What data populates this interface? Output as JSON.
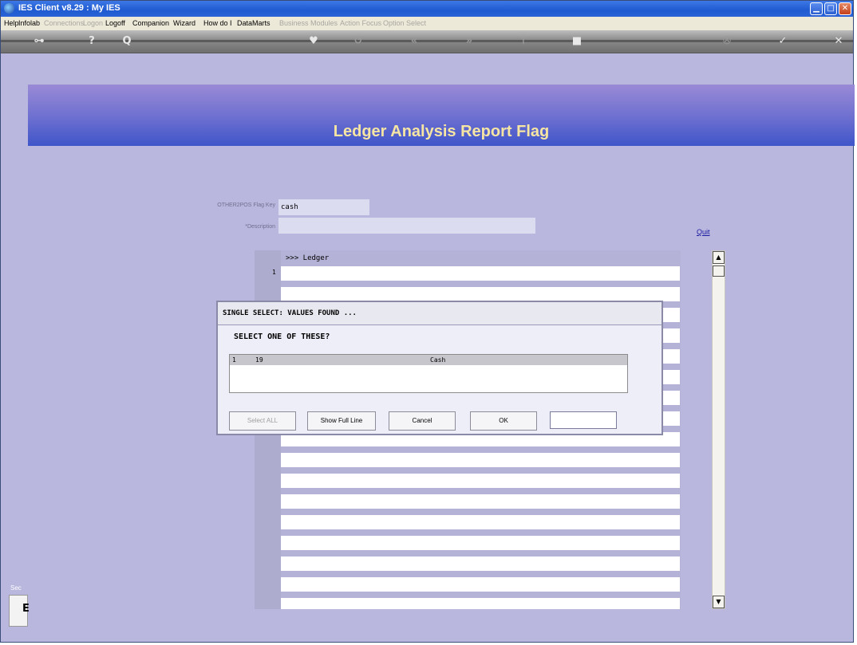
{
  "window": {
    "title": "IES Client v8.29 : My IES"
  },
  "menu": {
    "items": [
      {
        "label": "Help",
        "enabled": true
      },
      {
        "label": "Infolab",
        "enabled": true
      },
      {
        "label": "Connections",
        "enabled": false
      },
      {
        "label": "Logon",
        "enabled": false
      },
      {
        "label": "Logoff",
        "enabled": true
      },
      {
        "label": "Companion",
        "enabled": true
      },
      {
        "label": "Wizard",
        "enabled": true
      },
      {
        "label": "How do I",
        "enabled": true
      },
      {
        "label": "DataMarts",
        "enabled": true
      },
      {
        "label": "Business Modules",
        "enabled": false
      },
      {
        "label": "Action Focus",
        "enabled": false
      },
      {
        "label": "Option Select",
        "enabled": false
      }
    ]
  },
  "toolbar": {
    "icons": [
      "key-icon",
      "help-icon",
      "search-icon",
      "heart-icon",
      "refresh-icon",
      "rewind-icon",
      "forward-icon",
      "insert-icon",
      "stop-icon",
      "home-icon",
      "check-icon",
      "close-icon"
    ],
    "glyphs": [
      "⊶",
      "?",
      "Q",
      "♥",
      "↺",
      "«",
      "»",
      "⊤",
      "■",
      "✇",
      "✓",
      "✕"
    ]
  },
  "banner": {
    "title": "Ledger Analysis Report Flag"
  },
  "form": {
    "flag_key_label": "OTHER2POS Flag Key",
    "flag_key_value": "cash",
    "description_label": "*Description",
    "description_value": "",
    "quit_label": "Quit"
  },
  "grid": {
    "header": ">>> Ledger",
    "first_row_number": "1"
  },
  "dialog": {
    "title": "SINGLE SELECT: VALUES FOUND ...",
    "prompt": "SELECT ONE OF THESE?",
    "row": {
      "index": "1",
      "code": "19",
      "name": "Cash"
    },
    "buttons": {
      "select_all": "Select ALL",
      "show_full_line": "Show Full Line",
      "cancel": "Cancel",
      "ok": "OK"
    },
    "input_value": ""
  },
  "side": {
    "sec_label": "Sec",
    "e_label": "E"
  },
  "colors": {
    "banner_title": "#f6e5a3",
    "background": "#b9b7dd",
    "titlebar": "#2a62d6"
  }
}
